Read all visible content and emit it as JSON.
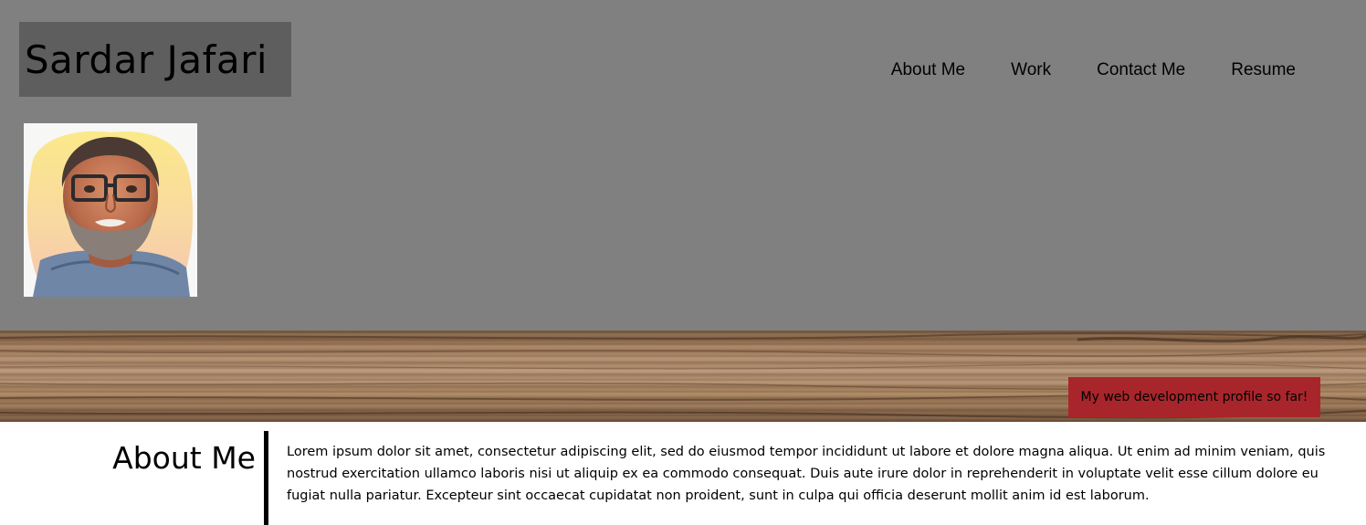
{
  "header": {
    "name": "Sardar Jafari",
    "background": "#808080",
    "name_box_color": "#5e5e5e"
  },
  "nav": {
    "items": [
      {
        "label": "About Me"
      },
      {
        "label": "Work"
      },
      {
        "label": "Contact Me"
      },
      {
        "label": "Resume"
      }
    ]
  },
  "profile": {
    "avatar_icon": "profile-photo"
  },
  "banner": {
    "tagline": "My web development profile so far!",
    "tagline_color": "#a8262b"
  },
  "about": {
    "heading": "About Me",
    "text": "Lorem ipsum dolor sit amet, consectetur adipiscing elit, sed do eiusmod tempor incididunt ut labore et dolore magna aliqua. Ut enim ad minim veniam, quis nostrud exercitation ullamco laboris nisi ut aliquip ex ea commodo consequat. Duis aute irure dolor in reprehenderit in voluptate velit esse cillum dolore eu fugiat nulla pariatur. Excepteur sint occaecat cupidatat non proident, sunt in culpa qui officia deserunt mollit anim id est laborum."
  }
}
